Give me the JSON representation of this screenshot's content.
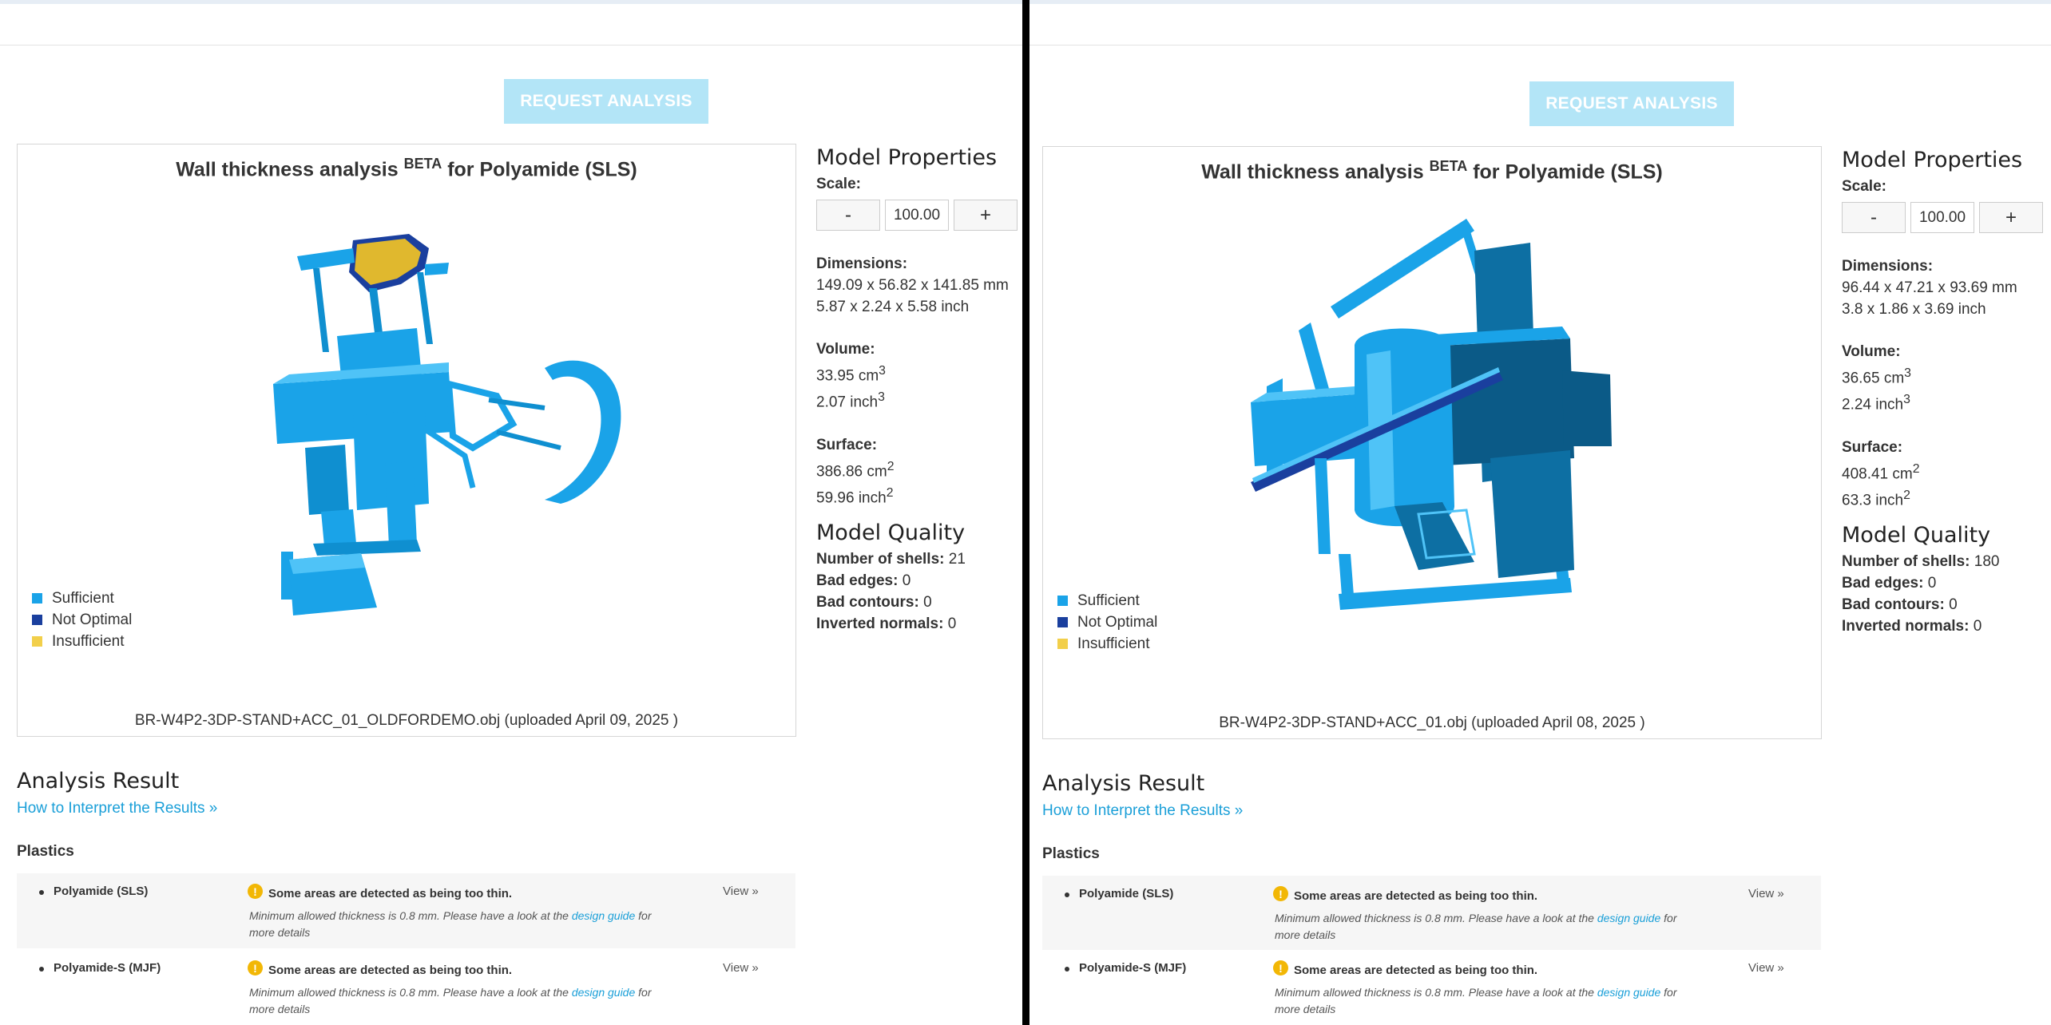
{
  "panes": [
    {
      "request_button": "REQUEST ANALYSIS",
      "viewer": {
        "title_prefix": "Wall thickness analysis",
        "title_sup": "BETA",
        "title_suffix": "for Polyamide (SLS)",
        "legend": [
          {
            "label": "Sufficient",
            "color": "#1aa3e8"
          },
          {
            "label": "Not Optimal",
            "color": "#1a3f9e"
          },
          {
            "label": "Insufficient",
            "color": "#f2cf4a"
          }
        ],
        "filename": "BR-W4P2-3DP-STAND+ACC_01_OLDFORDEMO.obj (uploaded April 09, 2025 )"
      },
      "properties": {
        "heading": "Model Properties",
        "scale_label": "Scale:",
        "scale_minus": "-",
        "scale_value": "100.00",
        "scale_plus": "+",
        "dimensions_label": "Dimensions:",
        "dimensions_mm": "149.09 x 56.82 x 141.85 mm",
        "dimensions_inch": "5.87 x 2.24 x 5.58 inch",
        "volume_label": "Volume:",
        "volume_cm": "33.95 cm",
        "volume_inch": "2.07 inch",
        "volume_exp": "3",
        "surface_label": "Surface:",
        "surface_cm": "386.86 cm",
        "surface_inch": "59.96 inch",
        "surface_exp": "2"
      },
      "quality": {
        "heading": "Model Quality",
        "shells_label": "Number of shells:",
        "shells_value": "21",
        "edges_label": "Bad edges:",
        "edges_value": "0",
        "contours_label": "Bad contours:",
        "contours_value": "0",
        "normals_label": "Inverted normals:",
        "normals_value": "0"
      },
      "analysis": {
        "title": "Analysis Result",
        "interpret_link": "How to Interpret the Results »",
        "category": "Plastics",
        "results": [
          {
            "material": "Polyamide (SLS)",
            "message": "Some areas are detected as being too thin.",
            "detail_pre": "Minimum allowed thickness is 0.8 mm. Please have a look at the",
            "detail_link": "design guide",
            "detail_post": "for more details",
            "view": "View »"
          },
          {
            "material": "Polyamide-S (MJF)",
            "message": "Some areas are detected as being too thin.",
            "detail_pre": "Minimum allowed thickness is 0.8 mm. Please have a look at the",
            "detail_link": "design guide",
            "detail_post": "for more details",
            "view": "View »"
          }
        ]
      }
    },
    {
      "request_button": "REQUEST ANALYSIS",
      "viewer": {
        "title_prefix": "Wall thickness analysis",
        "title_sup": "BETA",
        "title_suffix": "for Polyamide (SLS)",
        "legend": [
          {
            "label": "Sufficient",
            "color": "#1aa3e8"
          },
          {
            "label": "Not Optimal",
            "color": "#1a3f9e"
          },
          {
            "label": "Insufficient",
            "color": "#f2cf4a"
          }
        ],
        "filename": "BR-W4P2-3DP-STAND+ACC_01.obj (uploaded April 08, 2025 )"
      },
      "properties": {
        "heading": "Model Properties",
        "scale_label": "Scale:",
        "scale_minus": "-",
        "scale_value": "100.00",
        "scale_plus": "+",
        "dimensions_label": "Dimensions:",
        "dimensions_mm": "96.44 x 47.21 x 93.69 mm",
        "dimensions_inch": "3.8 x 1.86 x 3.69 inch",
        "volume_label": "Volume:",
        "volume_cm": "36.65 cm",
        "volume_inch": "2.24 inch",
        "volume_exp": "3",
        "surface_label": "Surface:",
        "surface_cm": "408.41 cm",
        "surface_inch": "63.3 inch",
        "surface_exp": "2"
      },
      "quality": {
        "heading": "Model Quality",
        "shells_label": "Number of shells:",
        "shells_value": "180",
        "edges_label": "Bad edges:",
        "edges_value": "0",
        "contours_label": "Bad contours:",
        "contours_value": "0",
        "normals_label": "Inverted normals:",
        "normals_value": "0"
      },
      "analysis": {
        "title": "Analysis Result",
        "interpret_link": "How to Interpret the Results »",
        "category": "Plastics",
        "results": [
          {
            "material": "Polyamide (SLS)",
            "message": "Some areas are detected as being too thin.",
            "detail_pre": "Minimum allowed thickness is 0.8 mm. Please have a look at the",
            "detail_link": "design guide",
            "detail_post": "for more details",
            "view": "View »"
          },
          {
            "material": "Polyamide-S (MJF)",
            "message": "Some areas are detected as being too thin.",
            "detail_pre": "Minimum allowed thickness is 0.8 mm. Please have a look at the",
            "detail_link": "design guide",
            "detail_post": "for more details",
            "view": "View »"
          }
        ]
      }
    }
  ]
}
